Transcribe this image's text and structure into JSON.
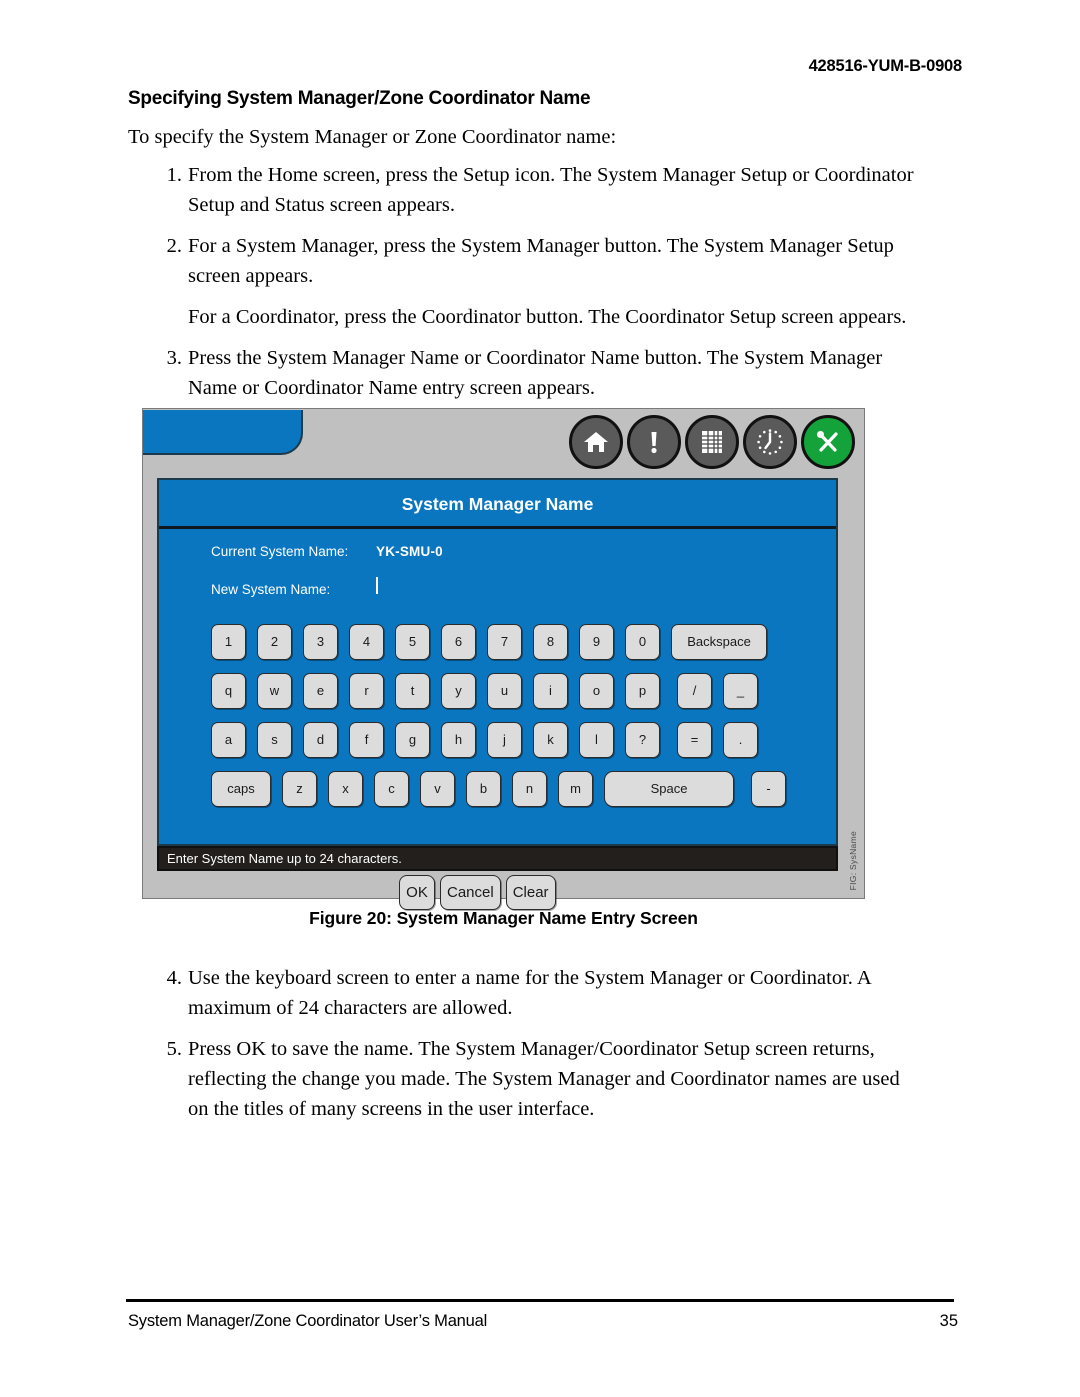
{
  "document": {
    "doc_code": "428516-YUM-B-0908",
    "section_title": "Specifying System Manager/Zone Coordinator Name",
    "intro": "To specify the System Manager or Zone Coordinator name:",
    "figure_caption": "Figure 20: System Manager Name Entry Screen",
    "footer_title": "System Manager/Zone Coordinator User’s Manual",
    "footer_page": "35"
  },
  "steps_top": [
    {
      "num": "1.",
      "text": "From the Home screen, press the Setup icon. The System Manager Setup or Coordinator Setup and Status screen appears."
    },
    {
      "num": "2.",
      "text": "For a System Manager, press the System Manager button. The System Manager Setup screen appears."
    },
    {
      "num": "",
      "text": "For a Coordinator, press the Coordinator button. The Coordinator Setup screen appears."
    },
    {
      "num": "3.",
      "text": "Press the System Manager Name or Coordinator Name button. The System Manager Name or Coordinator Name entry screen appears."
    }
  ],
  "steps_bottom": [
    {
      "num": "4.",
      "text": "Use the keyboard screen to enter a name for the System Manager or Coordinator. A maximum of 24 characters are allowed."
    },
    {
      "num": "5.",
      "text": "Press OK to save the name. The System Manager/Coordinator Setup screen returns, reflecting the change you made. The System Manager and Coordinator names are used on the titles of many screens in the user interface."
    }
  ],
  "figure": {
    "vertical_label": "FIG: SysName",
    "toolbar": [
      {
        "icon": "home-icon",
        "color": "#5a5a5a"
      },
      {
        "icon": "alarm-exclamation-icon",
        "color": "#5a5a5a"
      },
      {
        "icon": "schedule-grid-icon",
        "color": "#5a5a5a"
      },
      {
        "icon": "clock-icon",
        "color": "#5a5a5a"
      },
      {
        "icon": "tools-setup-icon",
        "color": "#13a33a"
      }
    ],
    "panel": {
      "title": "System Manager Name",
      "current_name_label": "Current System Name:",
      "current_name_value": "YK-SMU-0",
      "new_name_label": "New System Name:",
      "new_name_value": ""
    },
    "keyboard": {
      "row1": [
        "1",
        "2",
        "3",
        "4",
        "5",
        "6",
        "7",
        "8",
        "9",
        "0"
      ],
      "row1_special": "Backspace",
      "row2": [
        "q",
        "w",
        "e",
        "r",
        "t",
        "y",
        "u",
        "i",
        "o",
        "p"
      ],
      "row2_special": [
        "/",
        "_"
      ],
      "row3": [
        "a",
        "s",
        "d",
        "f",
        "g",
        "h",
        "j",
        "k",
        "l",
        "?"
      ],
      "row3_special": [
        "=",
        "."
      ],
      "row4_caps": "caps",
      "row4": [
        "z",
        "x",
        "c",
        "v",
        "b",
        "n",
        "m"
      ],
      "row4_space": "Space",
      "row4_special": "-"
    },
    "status_text": "Enter System Name up to 24 characters.",
    "actions": [
      "OK",
      "Cancel",
      "Clear"
    ],
    "colors": {
      "panel_blue": "#0a76bf",
      "frame_gray": "#c0c0c0",
      "key_gray": "#dcdcdc",
      "status_black": "#231f1c",
      "setup_green": "#13a33a"
    }
  }
}
